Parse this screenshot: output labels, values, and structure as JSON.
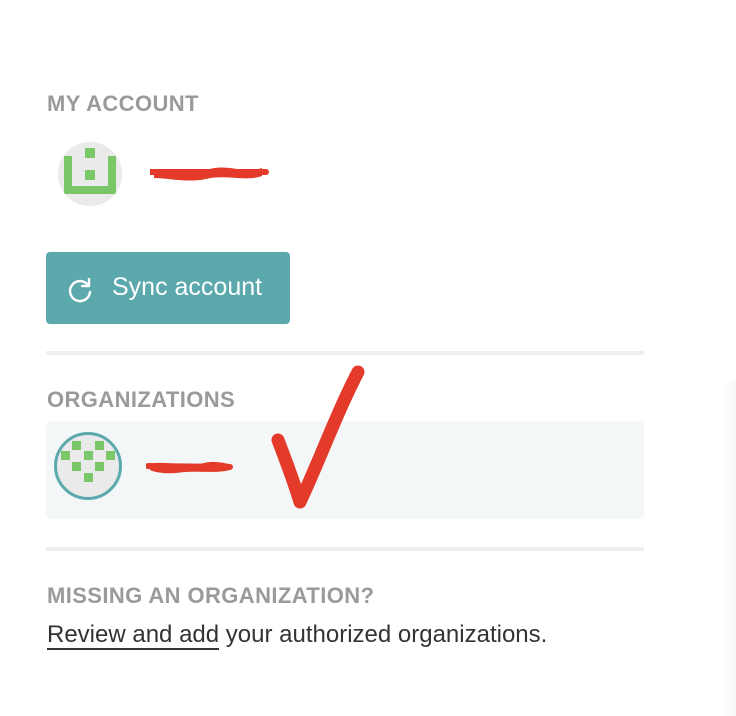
{
  "account": {
    "heading": "MY ACCOUNT",
    "user_name": "",
    "name_redacted": true
  },
  "sync_button": {
    "label": "Sync account",
    "icon": "sync-icon"
  },
  "organizations": {
    "heading": "ORGANIZATIONS",
    "items": [
      {
        "name": "",
        "name_redacted": true,
        "selected": true
      }
    ],
    "annotation": "red-checkmark"
  },
  "missing": {
    "heading": "MISSING AN ORGANIZATION?",
    "link_text": "Review and add",
    "rest_text": " your authorized organizations."
  },
  "colors": {
    "accent": "#5ca9ad",
    "heading_gray": "#9a9a9a",
    "identicon_green": "#7ac76a",
    "annotation_red": "#e33a2a",
    "divider": "#eeeeee",
    "org_row_bg": "#f4f7f7"
  }
}
